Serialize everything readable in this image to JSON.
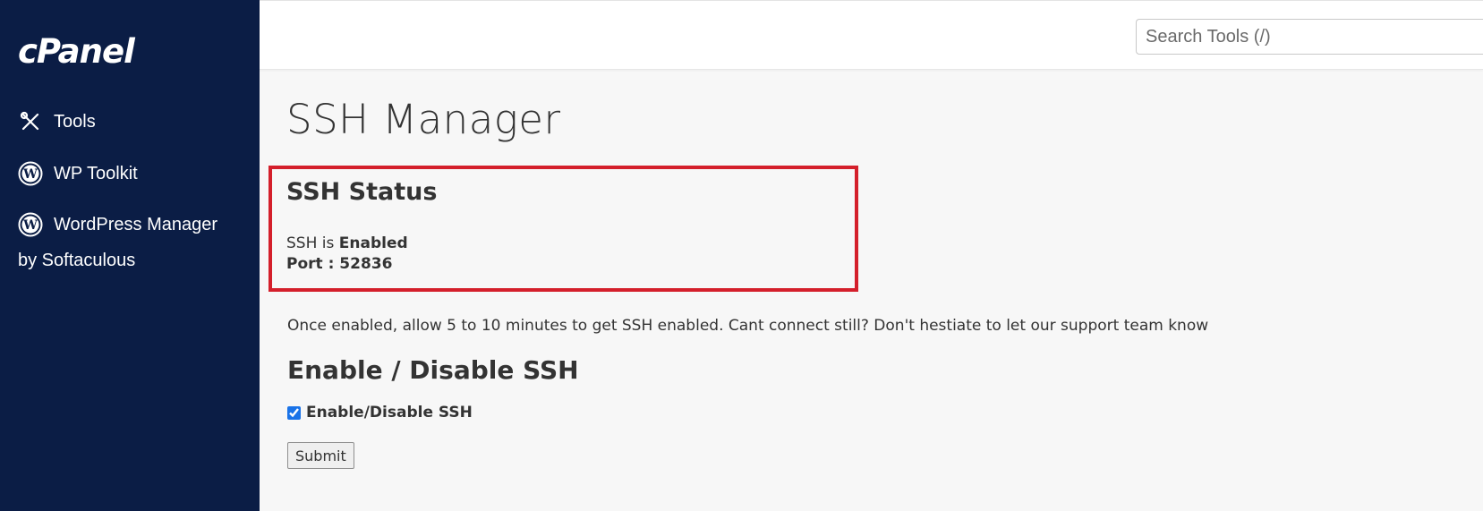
{
  "sidebar": {
    "logo": "cPanel",
    "items": [
      {
        "label": "Tools",
        "icon": "tools-icon"
      },
      {
        "label": "WP Toolkit",
        "icon": "wordpress-icon"
      },
      {
        "label": "WordPress Manager",
        "icon": "wordpress-icon"
      }
    ],
    "wpm_sub": "by Softaculous"
  },
  "header": {
    "search_placeholder": "Search Tools (/)"
  },
  "main": {
    "title": "SSH Manager",
    "status": {
      "title": "SSH Status",
      "prefix": "SSH is ",
      "state": "Enabled",
      "port_label": "Port : 52836"
    },
    "info": "Once enabled, allow 5 to 10 minutes to get SSH enabled. Cant connect still? Don't hestiate to let our support team know",
    "toggle_section": {
      "title": "Enable / Disable SSH",
      "checkbox_label": "Enable/Disable SSH",
      "checked": true
    },
    "submit_label": "Submit"
  },
  "colors": {
    "sidebar_bg": "#0b1d45",
    "highlight_border": "#d41f2b",
    "page_bg": "#f7f7f7"
  }
}
